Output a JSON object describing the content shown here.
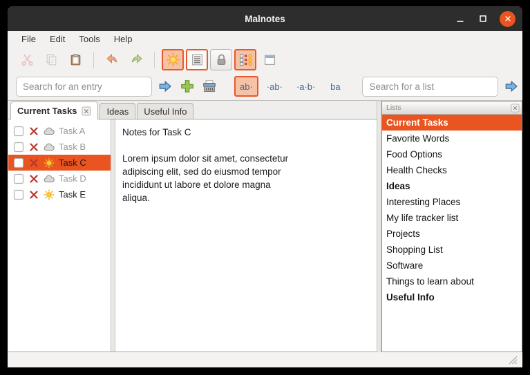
{
  "window": {
    "title": "Malnotes",
    "accent_color": "#e95420"
  },
  "menus": [
    {
      "label": "File"
    },
    {
      "label": "Edit"
    },
    {
      "label": "Tools"
    },
    {
      "label": "Help"
    }
  ],
  "toolbar": {
    "buttons": [
      {
        "icon": "cut",
        "disabled": true
      },
      {
        "icon": "copy",
        "disabled": true
      },
      {
        "icon": "paste"
      },
      {
        "separator": true
      },
      {
        "icon": "undo"
      },
      {
        "icon": "redo"
      },
      {
        "separator": true
      },
      {
        "icon": "sun-toggle",
        "active": true
      },
      {
        "icon": "list-toggle",
        "active": true,
        "active_bg": "white"
      },
      {
        "icon": "lock-toggle",
        "framed": true
      },
      {
        "icon": "grid-toggle",
        "active": true
      },
      {
        "icon": "new-note"
      }
    ]
  },
  "search": {
    "entry": {
      "placeholder": "Search for an entry",
      "value": "",
      "buttons": [
        "go-arrow",
        "add-plus",
        "shred"
      ]
    },
    "match_modes": [
      {
        "label": "ab·",
        "active": true
      },
      {
        "label": "·ab·"
      },
      {
        "label": "·a·b·"
      },
      {
        "label": "ba"
      }
    ],
    "list": {
      "placeholder": "Search for a list",
      "value": "",
      "buttons": [
        "go-arrow",
        "add-plus",
        "shred"
      ]
    }
  },
  "tabs": [
    {
      "label": "Current Tasks",
      "active": true,
      "closable": true
    },
    {
      "label": "Ideas"
    },
    {
      "label": "Useful Info"
    }
  ],
  "tasks": [
    {
      "label": "Task A",
      "icon": "cloud",
      "dimmed": true
    },
    {
      "label": "Task B",
      "icon": "cloud",
      "dimmed": true
    },
    {
      "label": "Task C",
      "icon": "sun",
      "selected": true
    },
    {
      "label": "Task D",
      "icon": "cloud",
      "dimmed": true
    },
    {
      "label": "Task E",
      "icon": "sun"
    }
  ],
  "editor": {
    "text": "Notes for Task C\n\nLorem ipsum dolor sit amet, consectetur\nadipiscing elit, sed do eiusmod tempor\nincididunt ut labore et dolore magna\naliqua."
  },
  "lists_panel": {
    "title": "Lists",
    "items": [
      {
        "label": "Current Tasks",
        "selected": true,
        "bold": true
      },
      {
        "label": "Favorite Words"
      },
      {
        "label": "Food Options"
      },
      {
        "label": "Health Checks"
      },
      {
        "label": "Ideas",
        "bold": true
      },
      {
        "label": "Interesting Places"
      },
      {
        "label": "My life tracker list"
      },
      {
        "label": "Projects"
      },
      {
        "label": "Shopping List"
      },
      {
        "label": "Software"
      },
      {
        "label": "Things to learn about"
      },
      {
        "label": "Useful Info",
        "bold": true
      }
    ]
  }
}
